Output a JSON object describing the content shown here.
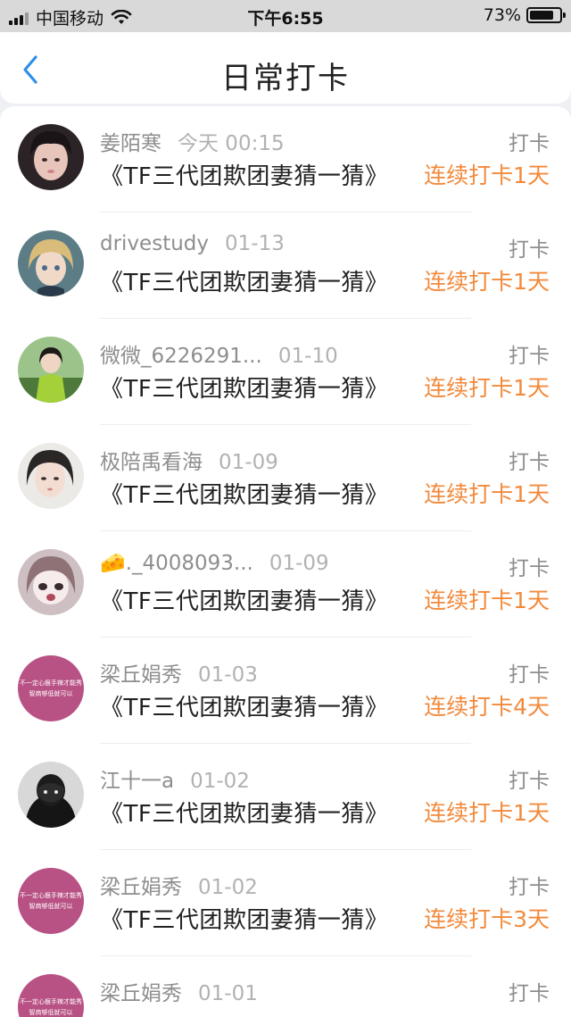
{
  "status": {
    "carrier": "中国移动",
    "time": "下午6:55",
    "battery": "73%",
    "battery_level": 0.73
  },
  "header": {
    "title": "日常打卡"
  },
  "rows": [
    {
      "name": "姜陌寒",
      "date": "今天 00:15",
      "action": "打卡",
      "topic": "《TF三代团欺团妻猜一猜》",
      "streak": "连续打卡1天"
    },
    {
      "name": "drivestudy",
      "date": "01-13",
      "action": "打卡",
      "topic": "《TF三代团欺团妻猜一猜》",
      "streak": "连续打卡1天"
    },
    {
      "name": "微微_6226291...",
      "date": "01-10",
      "action": "打卡",
      "topic": "《TF三代团欺团妻猜一猜》",
      "streak": "连续打卡1天"
    },
    {
      "name": "极陪禹看海",
      "date": "01-09",
      "action": "打卡",
      "topic": "《TF三代团欺团妻猜一猜》",
      "streak": "连续打卡1天"
    },
    {
      "name": "🧀._4008093...",
      "date": "01-09",
      "action": "打卡",
      "topic": "《TF三代团欺团妻猜一猜》",
      "streak": "连续打卡1天"
    },
    {
      "name": "梁丘娟秀",
      "date": "01-03",
      "action": "打卡",
      "topic": "《TF三代团欺团妻猜一猜》",
      "streak": "连续打卡4天"
    },
    {
      "name": "江十一a",
      "date": "01-02",
      "action": "打卡",
      "topic": "《TF三代团欺团妻猜一猜》",
      "streak": "连续打卡1天"
    },
    {
      "name": "梁丘娟秀",
      "date": "01-02",
      "action": "打卡",
      "topic": "《TF三代团欺团妻猜一猜》",
      "streak": "连续打卡3天"
    },
    {
      "name": "梁丘娟秀",
      "date": "01-01",
      "action": "打卡",
      "topic": "",
      "streak": ""
    }
  ],
  "avatar_text": {
    "line1": "不一定心狠手辣才能秀",
    "line2": "智商够低就可以"
  },
  "colors": {
    "accent_blue": "#2f8fe8",
    "streak_orange": "#f28a3c",
    "avatar_pink": "#b85184"
  },
  "icons": {
    "back": "chevron-left-icon",
    "wifi": "wifi-icon",
    "signal": "signal-icon",
    "battery": "battery-icon"
  }
}
